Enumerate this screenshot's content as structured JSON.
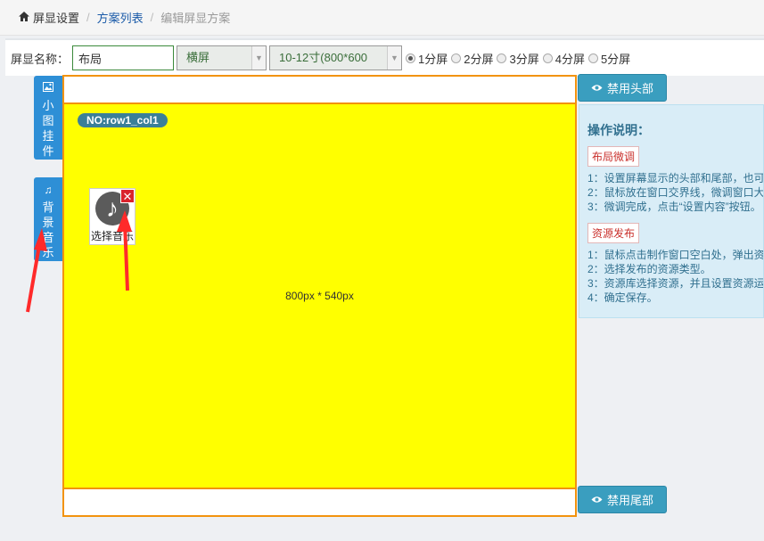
{
  "breadcrumb": {
    "home": "屏显设置",
    "list": "方案列表",
    "current": "编辑屏显方案"
  },
  "form": {
    "name_label": "屏显名称：",
    "name_value": "布局",
    "orientation": "横屏",
    "size": "10-12寸(800*600",
    "screens": [
      "1分屏",
      "2分屏",
      "3分屏",
      "4分屏",
      "5分屏"
    ],
    "screens_selected": 0
  },
  "side_tabs": {
    "widget": "小图挂件",
    "music": "背景音乐"
  },
  "canvas": {
    "row_badge": "NO:row1_col1",
    "dimensions": "800px * 540px",
    "music_widget_label": "选择音乐"
  },
  "buttons": {
    "disable_header": "禁用头部",
    "disable_footer": "禁用尾部"
  },
  "help": {
    "title": "操作说明：",
    "layout_tag": "布局微调",
    "layout_steps": [
      "1：设置屏幕显示的头部和尾部，也可",
      "2：鼠标放在窗口交界线，微调窗口大",
      "3：微调完成，点击“设置内容”按钮。"
    ],
    "publish_tag": "资源发布",
    "publish_steps": [
      "1：鼠标点击制作窗口空白处，弹出资",
      "2：选择发布的资源类型。",
      "3：资源库选择资源，并且设置资源运",
      "4：确定保存。"
    ]
  },
  "colors": {
    "canvas_bg": "#ffff00",
    "canvas_border": "#f2930e",
    "tab_blue": "#2e8fd6",
    "button_teal": "#3a9ebf",
    "help_bg": "#d9edf7",
    "arrow_red": "#ff2a2a"
  }
}
